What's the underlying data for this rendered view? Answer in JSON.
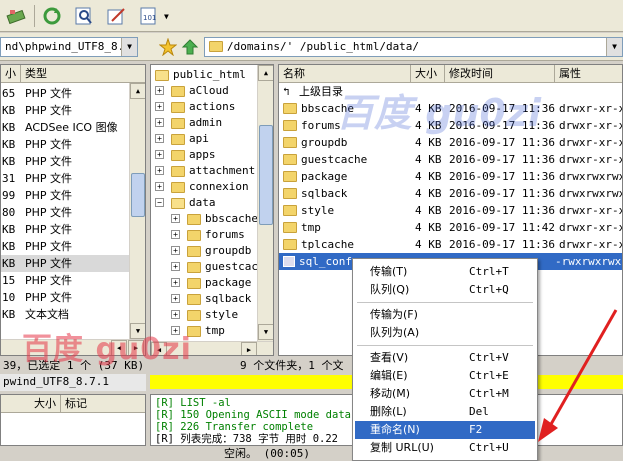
{
  "left_panel": {
    "path": "nd\\phpwind_UTF8_8.7.1",
    "headers": [
      "小",
      "类型"
    ],
    "rows": [
      {
        "size": "65",
        "type": "PHP 文件"
      },
      {
        "size": "KB",
        "type": "PHP 文件"
      },
      {
        "size": "KB",
        "type": "ACDSee ICO 图像"
      },
      {
        "size": "KB",
        "type": "PHP 文件"
      },
      {
        "size": "KB",
        "type": "PHP 文件"
      },
      {
        "size": "31",
        "type": "PHP 文件"
      },
      {
        "size": "99",
        "type": "PHP 文件"
      },
      {
        "size": "80",
        "type": "PHP 文件"
      },
      {
        "size": "KB",
        "type": "PHP 文件"
      },
      {
        "size": "KB",
        "type": "PHP 文件"
      },
      {
        "size": "KB",
        "type": "PHP 文件"
      },
      {
        "size": "15",
        "type": "PHP 文件"
      },
      {
        "size": "10",
        "type": "PHP 文件"
      },
      {
        "size": "KB",
        "type": "文本文档"
      }
    ],
    "status1": "39，已选定 1 个 (37 KB)",
    "status2": "pwind_UTF8_8.7.1",
    "queue_headers": [
      "大小",
      "标记"
    ]
  },
  "tree": {
    "root": "public_html",
    "items": [
      "aCloud",
      "actions",
      "admin",
      "api",
      "apps",
      "attachment",
      "connexion",
      "data"
    ],
    "children": [
      "bbscache",
      "forums",
      "groupdb",
      "guestcac",
      "package",
      "sqlback",
      "style",
      "tmp"
    ]
  },
  "remote": {
    "path": "/domains/'                /public_html/data/",
    "headers": {
      "name": "名称",
      "size": "大小",
      "modified": "修改时间",
      "attr": "属性"
    },
    "up": "上级目录",
    "rows": [
      {
        "name": "bbscache",
        "size": "4 KB",
        "date": "2016-09-17 11:36",
        "attr": "drwxr-xr-x"
      },
      {
        "name": "forums",
        "size": "4 KB",
        "date": "2016-09-17 11:36",
        "attr": "drwxr-xr-x"
      },
      {
        "name": "groupdb",
        "size": "4 KB",
        "date": "2016-09-17 11:36",
        "attr": "drwxr-xr-x"
      },
      {
        "name": "guestcache",
        "size": "4 KB",
        "date": "2016-09-17 11:36",
        "attr": "drwxr-xr-x"
      },
      {
        "name": "package",
        "size": "4 KB",
        "date": "2016-09-17 11:36",
        "attr": "drwxrwxrwx"
      },
      {
        "name": "sqlback",
        "size": "4 KB",
        "date": "2016-09-17 11:36",
        "attr": "drwxrwxrwx"
      },
      {
        "name": "style",
        "size": "4 KB",
        "date": "2016-09-17 11:36",
        "attr": "drwxr-xr-x"
      },
      {
        "name": "tmp",
        "size": "4 KB",
        "date": "2016-09-17 11:42",
        "attr": "drwxr-xr-x"
      },
      {
        "name": "tplcache",
        "size": "4 KB",
        "date": "2016-09-17 11:36",
        "attr": "drwxr-xr-x"
      }
    ],
    "selected": {
      "name": "sql_conf",
      "attr": "-rwxrwxrwx"
    },
    "status": "9 个文件夹，1 个文"
  },
  "log": [
    "[R] LIST -al",
    "[R] 150 Opening ASCII mode data c",
    "[R] 226 Transfer complete",
    "[R] 列表完成：738 字节 用时 0.22"
  ],
  "bottom_status": "空闲。 (00:05)",
  "context_menu": [
    {
      "label": "传输(T)",
      "shortcut": "Ctrl+T"
    },
    {
      "label": "队列(Q)",
      "shortcut": "Ctrl+Q"
    },
    {
      "sep": true
    },
    {
      "label": "传输为(F)",
      "shortcut": ""
    },
    {
      "label": "队列为(A)",
      "shortcut": ""
    },
    {
      "sep": true
    },
    {
      "label": "查看(V)",
      "shortcut": "Ctrl+V"
    },
    {
      "label": "编辑(E)",
      "shortcut": "Ctrl+E"
    },
    {
      "label": "移动(M)",
      "shortcut": "Ctrl+M"
    },
    {
      "label": "删除(L)",
      "shortcut": "Del"
    },
    {
      "label": "重命名(N)",
      "shortcut": "F2"
    },
    {
      "label": "复制 URL(U)",
      "shortcut": "Ctrl+U"
    }
  ],
  "watermarks": {
    "left": "百度 gu0zi",
    "top": "百度 gu0zi"
  },
  "colors": {
    "highlight": "#316ac5",
    "status_yellow": "#ffff00",
    "log_green": "#008000"
  }
}
